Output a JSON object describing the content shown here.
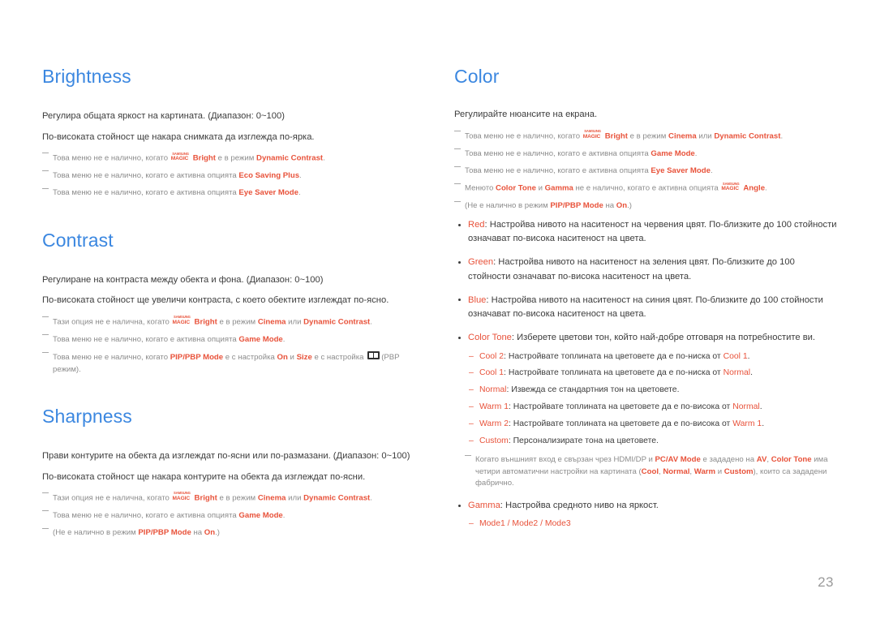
{
  "page": {
    "number": "23",
    "heading_color": "#3b87e0",
    "highlight_color": "#e8523a",
    "body_color": "#3c3c3c",
    "note_color": "#8c8c8c",
    "background": "#ffffff"
  },
  "magic_logo": {
    "top": "SAMSUNG",
    "bottom": "MAGIC"
  },
  "left_column": {
    "brightness": {
      "title": "Brightness",
      "desc1": "Регулира общата яркост на картината. (Диапазон: 0~100)",
      "desc2": "По-високата стойност ще накара снимката да изглежда по-ярка.",
      "note1": {
        "pre": "Това меню не е налично, когато ",
        "bold1": "Bright",
        "mid": " е в режим ",
        "bold2": "Dynamic Contrast",
        "post": "."
      },
      "note2": {
        "pre": "Това меню не е налично, когато е активна опцията ",
        "bold1": "Eco Saving Plus",
        "post": "."
      },
      "note3": {
        "pre": "Това меню не е налично, когато е активна опцията ",
        "bold1": "Eye Saver Mode",
        "post": "."
      }
    },
    "contrast": {
      "title": "Contrast",
      "desc1": "Регулиране на контраста между обекта и фона. (Диапазон: 0~100)",
      "desc2": "По-високата стойност ще увеличи контраста, с което обектите изглеждат по-ясно.",
      "note1": {
        "pre": "Тази опция не е налична, когато ",
        "bold1": "Bright",
        "mid": " е в режим ",
        "bold2": "Cinema",
        "mid2": " или ",
        "bold3": "Dynamic Contrast",
        "post": "."
      },
      "note2": {
        "pre": "Това меню не е налично, когато е активна опцията ",
        "bold1": "Game Mode",
        "post": "."
      },
      "note3": {
        "pre": "Това меню не е налично, когато ",
        "bold1": "PIP/PBP Mode",
        "mid": " е с настройка ",
        "bold2": "On",
        "mid2": " и ",
        "bold3": "Size",
        "mid3": " е с настройка ",
        "post": "(PBP режим)."
      }
    },
    "sharpness": {
      "title": "Sharpness",
      "desc1": "Прави контурите на обекта да изглеждат по-ясни или по-размазани. (Диапазон: 0~100)",
      "desc2": "По-високата стойност ще накара контурите на обекта да изглеждат по-ясни.",
      "note1": {
        "pre": "Тази опция не е налична, когато ",
        "bold1": "Bright",
        "mid": " е в режим ",
        "bold2": "Cinema",
        "mid2": " или ",
        "bold3": "Dynamic Contrast",
        "post": "."
      },
      "note2": {
        "pre": "Това меню не е налично, когато е активна опцията ",
        "bold1": "Game Mode",
        "post": "."
      },
      "note3": {
        "pre": "(Не е налично в режим ",
        "bold1": "PIP/PBP Mode",
        "mid": " на ",
        "bold2": "On",
        "post": ".)"
      }
    }
  },
  "right_column": {
    "color": {
      "title": "Color",
      "desc1": "Регулирайте нюансите на екрана.",
      "note1": {
        "pre": "Това меню не е налично, когато ",
        "bold1": "Bright",
        "mid": " е в режим ",
        "bold2": "Cinema",
        "mid2": " или ",
        "bold3": "Dynamic Contrast",
        "post": "."
      },
      "note2": {
        "pre": "Това меню не е налично, когато е активна опцията ",
        "bold1": "Game Mode",
        "post": "."
      },
      "note3": {
        "pre": "Това меню не е налично, когато е активна опцията ",
        "bold1": "Eye Saver Mode",
        "post": "."
      },
      "note4": {
        "pre": "Менюто ",
        "bold1": "Color Tone",
        "mid": " и ",
        "bold2": "Gamma",
        "mid2": " не е налично, когато е активна опцията ",
        "bold3": "Angle",
        "post": "."
      },
      "note5": {
        "pre": "(Не е налично в режим ",
        "bold1": "PIP/PBP Mode",
        "mid": " на ",
        "bold2": "On",
        "post": ".)"
      },
      "bullet_red": {
        "label": "Red",
        "text": ": Настройва нивото на наситеност на червения цвят. По-близките до 100 стойности означават по-висока наситеност на цвета."
      },
      "bullet_green": {
        "label": "Green",
        "text": ": Настройва нивото на наситеност на зеления цвят. По-близките до 100 стойности означават по-висока наситеност на цвета."
      },
      "bullet_blue": {
        "label": "Blue",
        "text": ": Настройва нивото на наситеност на синия цвят. По-близките до 100 стойности означават по-висока наситеност на цвета."
      },
      "bullet_color_tone": {
        "label": "Color Tone",
        "text": ": Изберете цветови тон, който най-добре отговаря на потребностите ви."
      },
      "color_tone_items": [
        {
          "label": "Cool 2",
          "pre": ": Настройвате топлината на цветовете да е по-ниска от ",
          "ref": "Cool 1",
          "post": "."
        },
        {
          "label": "Cool 1",
          "pre": ": Настройвате топлината на цветовете да е по-ниска от ",
          "ref": "Normal",
          "post": "."
        },
        {
          "label": "Normal",
          "pre": ": Извежда се стандартния тон на цветовете.",
          "ref": "",
          "post": ""
        },
        {
          "label": "Warm 1",
          "pre": ": Настройвате топлината на цветовете да е по-висока от ",
          "ref": "Normal",
          "post": "."
        },
        {
          "label": "Warm 2",
          "pre": ": Настройвате топлината на цветовете да е по-висока от ",
          "ref": "Warm 1",
          "post": "."
        },
        {
          "label": "Custom",
          "pre": ": Персонализирате тона на цветовете.",
          "ref": "",
          "post": ""
        }
      ],
      "note6": {
        "pre": "Когато външният вход е свързан чрез HDMI/DP и ",
        "bold1": "PC/AV Mode",
        "mid": " е зададено на ",
        "bold2": "AV",
        "mid2": ", ",
        "bold3": "Color Tone",
        "mid3": " има четири автоматични настройки на картината (",
        "b4": "Cool",
        "s1": ", ",
        "b5": "Normal",
        "s2": ", ",
        "b6": "Warm",
        "s3": " и ",
        "b7": "Custom",
        "post": "), които са зададени фабрично."
      },
      "bullet_gamma": {
        "label": "Gamma",
        "text": ": Настройва средното ниво на яркост."
      },
      "gamma_modes": "Mode1 / Mode2 / Mode3"
    }
  }
}
